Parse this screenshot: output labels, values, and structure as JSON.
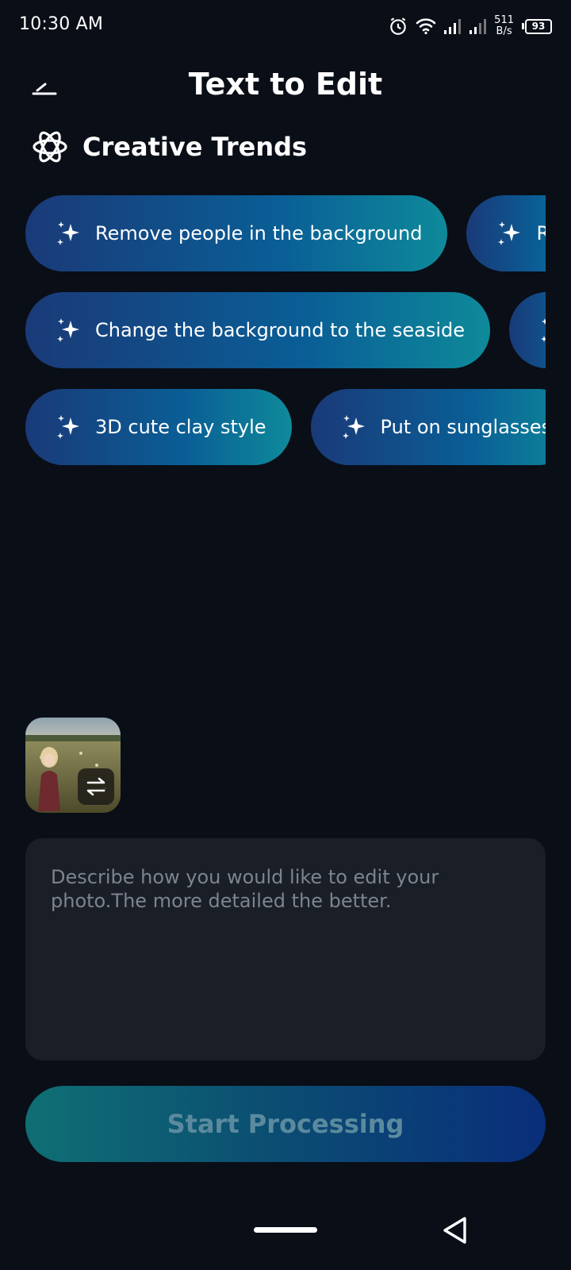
{
  "status_bar": {
    "time": "10:30 AM",
    "net_speed_value": "511",
    "net_speed_unit": "B/s",
    "battery": "93",
    "icons": [
      "alarm-icon",
      "wifi-icon",
      "signal-icon",
      "signal-icon",
      "battery-icon"
    ]
  },
  "header": {
    "title": "Text to Edit",
    "back_icon": "back-icon"
  },
  "section": {
    "icon": "atom-icon",
    "title": "Creative Trends"
  },
  "chips": {
    "icon": "sparkle-icon",
    "rows": [
      [
        "Remove people in the background",
        "Re"
      ],
      [
        "Change the background to the seaside",
        ""
      ],
      [
        "3D cute clay style",
        "Put on sunglasses"
      ]
    ]
  },
  "photo": {
    "swap_icon": "swap-icon"
  },
  "prompt": {
    "placeholder": "Describe how you would like to edit your photo.The more detailed the better.",
    "value": ""
  },
  "start_button": {
    "label": "Start Processing"
  },
  "colors": {
    "background": "#0a0e17",
    "chip_gradient_start": "#1a3a78",
    "chip_gradient_end": "#0e8a9a",
    "input_background": "#1a1e27",
    "button_gradient_start": "#0f6f74",
    "button_gradient_end": "#0a2e7a",
    "button_text": "#5b8a9e"
  }
}
